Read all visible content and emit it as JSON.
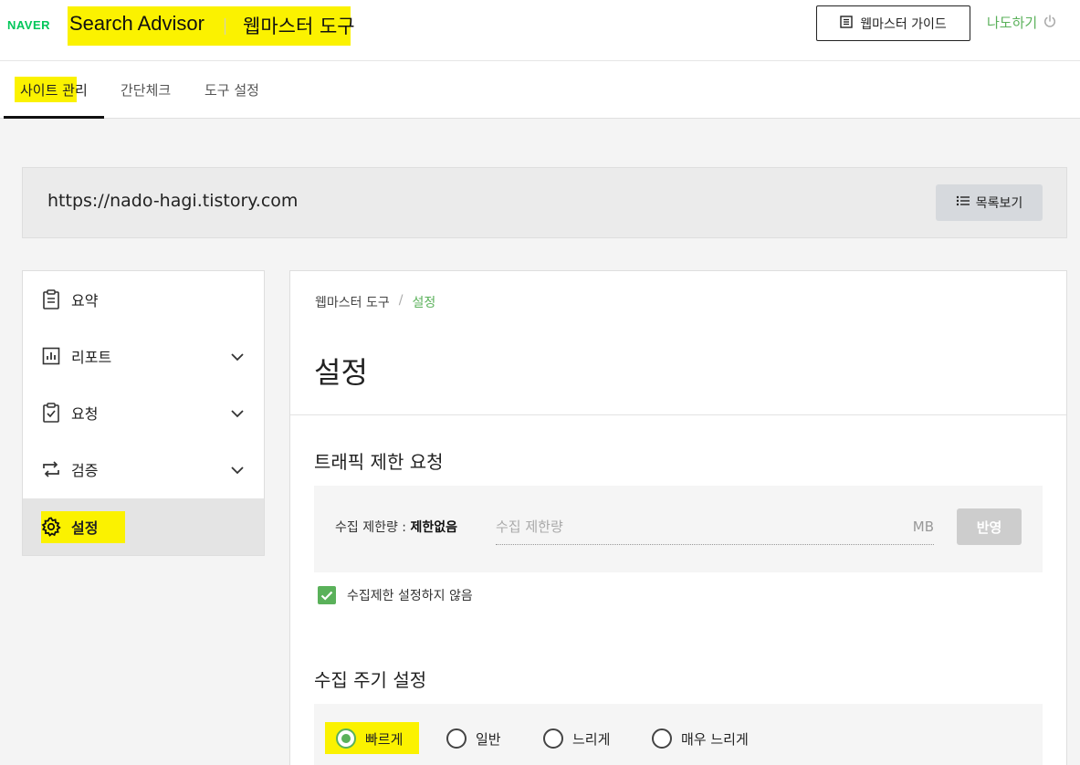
{
  "header": {
    "logo": "NAVER",
    "brand": "Search Advisor",
    "sub": "웹마스터 도구",
    "guide_button": "웹마스터 가이드",
    "user": "나도하기"
  },
  "tabs": [
    {
      "label": "사이트 관리",
      "active": true
    },
    {
      "label": "간단체크",
      "active": false
    },
    {
      "label": "도구 설정",
      "active": false
    }
  ],
  "site": {
    "url": "https://nado-hagi.tistory.com",
    "list_button": "목록보기"
  },
  "sidebar": {
    "items": [
      {
        "label": "요약",
        "icon": "clipboard-icon",
        "chevron": false
      },
      {
        "label": "리포트",
        "icon": "report-chart-icon",
        "chevron": true
      },
      {
        "label": "요청",
        "icon": "clipboard-check-icon",
        "chevron": true
      },
      {
        "label": "검증",
        "icon": "repeat-arrows-icon",
        "chevron": true
      },
      {
        "label": "설정",
        "icon": "gear-icon",
        "chevron": false,
        "active": true
      }
    ]
  },
  "main": {
    "breadcrumb": {
      "parent": "웹마스터 도구",
      "sep": "/",
      "current": "설정"
    },
    "title": "설정",
    "traffic": {
      "title": "트래픽 제한 요청",
      "label_prefix": "수집 제한량 : ",
      "label_value": "제한없음",
      "placeholder": "수집 제한량",
      "unit": "MB",
      "apply": "반영",
      "checkbox_label": "수집제한 설정하지 않음",
      "checked": true
    },
    "cycle": {
      "title": "수집 주기 설정",
      "options": [
        "빠르게",
        "일반",
        "느리게",
        "매우 느리게"
      ],
      "selected": "빠르게"
    }
  },
  "colors": {
    "accent": "#5ab15a",
    "highlight": "#fbf200",
    "naver": "#03c75a"
  }
}
